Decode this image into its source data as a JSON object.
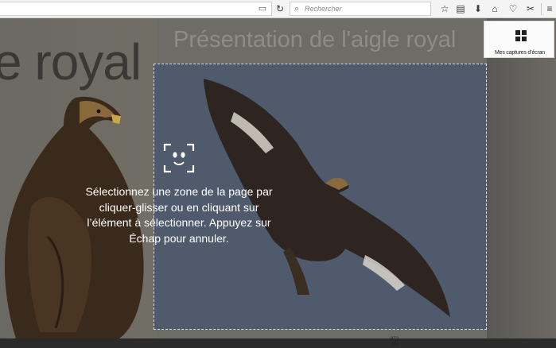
{
  "toolbar": {
    "search_placeholder": "Rechercher",
    "icons": [
      "reader-icon",
      "reload-icon",
      "search-icon",
      "bookmark-star-icon",
      "library-icon",
      "download-icon",
      "home-icon",
      "pocket-icon",
      "screenshot-icon",
      "menu-icon"
    ]
  },
  "page": {
    "big_title": "e royal",
    "title": "Présentation de l'aigle royal",
    "bottom_text": "— ————— ——— ——————— ——— —"
  },
  "overlay": {
    "instructions": "Sélectionnez une zone de la page par cliquer-glisser ou en cliquant sur l’élément à sélectionner. Appuyez sur Échap pour annuler.",
    "dims_w": "872",
    "dims_h": "496"
  },
  "my_shots": {
    "label": "Mes captures d’écran"
  },
  "colors": {
    "overlay": "#4f5b6c",
    "page": "#6c6a64",
    "toolbar": "#f4f4f4"
  }
}
